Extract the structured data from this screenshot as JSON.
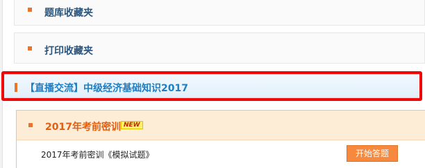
{
  "favorites": {
    "question_bank_label": "题库收藏夹",
    "print_label": "打印收藏夹"
  },
  "live_course": {
    "label": "【直播交流】中级经济基础知识2017"
  },
  "exam_section": {
    "title": "2017年考前密训",
    "badge": "NEW",
    "quiz": {
      "title": "2017年考前密训《模拟试题》",
      "start_button": "开始答题"
    }
  },
  "colors": {
    "accent_orange": "#e8752d",
    "link_blue": "#1f7ec2",
    "highlight_red": "#ef0606"
  }
}
